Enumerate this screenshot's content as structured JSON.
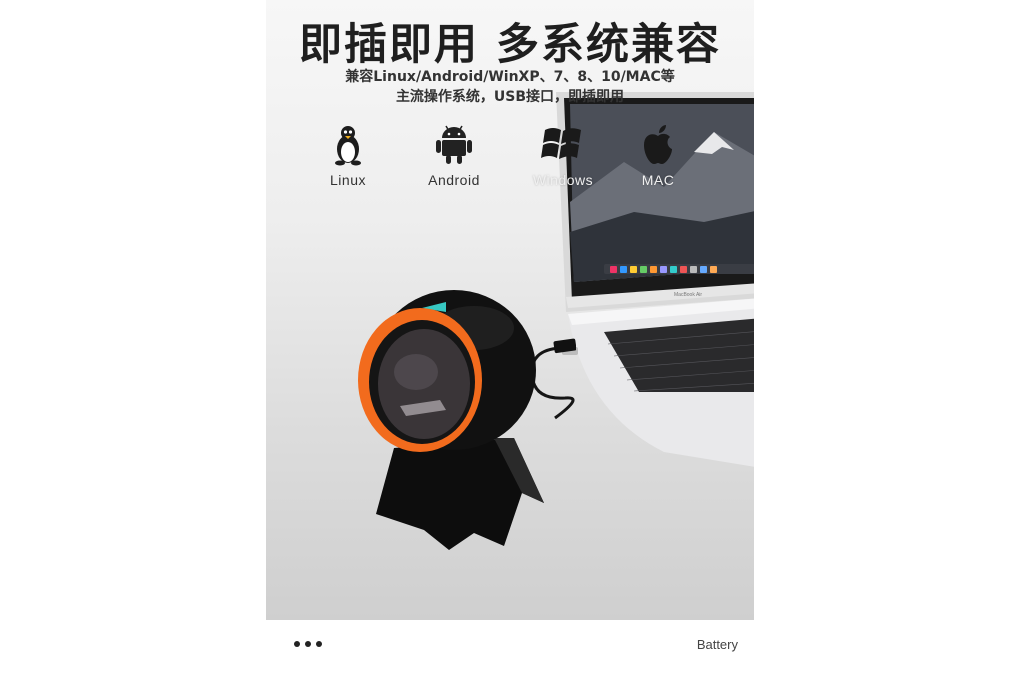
{
  "headline": "即插即用 多系统兼容",
  "subtitle": {
    "line1": "兼容Linux/Android/WinXP、7、8、10/MAC等",
    "line2": "主流操作系统，USB接口，即插即用"
  },
  "os_items": [
    {
      "label": "Linux",
      "icon": "penguin-icon"
    },
    {
      "label": "Android",
      "icon": "android-robot-icon"
    },
    {
      "label": "Windows",
      "icon": "windows-logo-icon"
    },
    {
      "label": "MAC",
      "icon": "apple-logo-icon"
    }
  ],
  "laptop_brand": "MacBook Air",
  "footer": {
    "more_icon": "more-dots-icon",
    "battery_label": "Battery"
  },
  "colors": {
    "accent_orange": "#f26b1d",
    "indicator_teal": "#37c8c2",
    "scanner_body": "#111111"
  }
}
